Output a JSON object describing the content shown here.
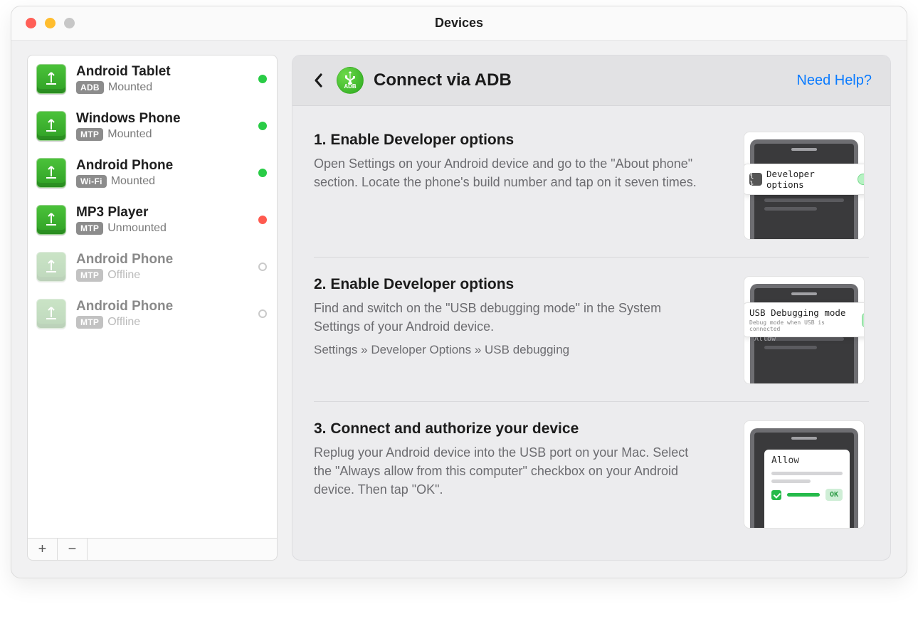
{
  "window": {
    "title": "Devices"
  },
  "sidebar": {
    "devices": [
      {
        "name": "Android Tablet",
        "protocol": "ADB",
        "status": "Mounted",
        "dot": "green",
        "offline": false
      },
      {
        "name": "Windows Phone",
        "protocol": "MTP",
        "status": "Mounted",
        "dot": "green",
        "offline": false
      },
      {
        "name": "Android Phone",
        "protocol": "Wi-Fi",
        "status": "Mounted",
        "dot": "green",
        "offline": false
      },
      {
        "name": "MP3 Player",
        "protocol": "MTP",
        "status": "Unmounted",
        "dot": "red",
        "offline": false
      },
      {
        "name": "Android Phone",
        "protocol": "MTP",
        "status": "Offline",
        "dot": "hollow",
        "offline": true
      },
      {
        "name": "Android Phone",
        "protocol": "MTP",
        "status": "Offline",
        "dot": "hollow",
        "offline": true
      }
    ],
    "add_label": "+",
    "remove_label": "−"
  },
  "panel": {
    "adb_badge": "ADB",
    "title": "Connect via ADB",
    "help_label": "Need Help?",
    "steps": [
      {
        "title": "1. Enable Developer options",
        "body": "Open Settings on your Android device and go to the \"About phone\" section. Locate the phone's build number and tap on it seven times.",
        "path": "",
        "illus": {
          "card_label": "Developer options",
          "card_sub": ""
        }
      },
      {
        "title": "2. Enable Developer options",
        "body": "Find and switch on the \"USB debugging mode\" in the System Settings of your Android device.",
        "path": "Settings » Developer Options » USB debugging",
        "illus": {
          "card_label": "USB Debugging mode",
          "card_sub": "Debug mode when USB is connected",
          "overlay": "Allow"
        }
      },
      {
        "title": "3. Connect and authorize your device",
        "body": "Replug your Android device into the USB port on your Mac. Select the \"Always allow from this computer\" checkbox on your Android device. Then tap \"OK\".",
        "path": "",
        "illus": {
          "allow_label": "Allow",
          "ok_label": "OK"
        }
      }
    ]
  }
}
